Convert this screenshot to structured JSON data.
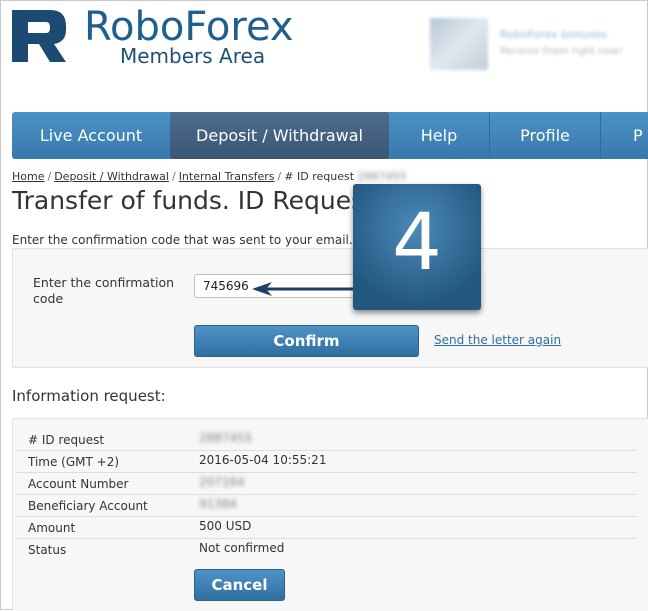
{
  "header": {
    "brand": "RoboForex",
    "subtitle": "Members Area",
    "promo_title": "RoboForex bonuses",
    "promo_text": "Receive them right now!"
  },
  "nav": {
    "items": [
      {
        "label": "Live Account"
      },
      {
        "label": "Deposit / Withdrawal",
        "active": true
      },
      {
        "label": "Help"
      },
      {
        "label": "Profile"
      },
      {
        "label": "P"
      }
    ]
  },
  "breadcrumb": {
    "items": [
      "Home",
      "Deposit / Withdrawal",
      "Internal Transfers",
      "# ID request"
    ],
    "id": "2887455"
  },
  "page": {
    "title": "Transfer of funds. ID Request",
    "hint": "Enter the confirmation code that was sent to your email."
  },
  "confirm_form": {
    "label": "Enter the confirmation code",
    "code_value": "745696",
    "confirm_label": "Confirm",
    "resend_label": "Send the letter again"
  },
  "info": {
    "title": "Information request:",
    "rows": [
      {
        "key": "# ID request",
        "value": "2887455",
        "hidden": true
      },
      {
        "key": "Time (GMT +2)",
        "value": "2016-05-04 10:55:21"
      },
      {
        "key": "Account Number",
        "value": "207164",
        "hidden": true
      },
      {
        "key": "Beneficiary Account",
        "value": "91384",
        "hidden": true
      },
      {
        "key": "Amount",
        "value": "500 USD"
      },
      {
        "key": "Status",
        "value": "Not confirmed"
      }
    ],
    "cancel_label": "Cancel"
  },
  "annotation": {
    "step": "4"
  },
  "colors": {
    "nav_blue": "#3f85ba",
    "nav_active": "#45617f",
    "button_blue": "#3b7fb2",
    "brand_blue": "#1f5f8e"
  }
}
